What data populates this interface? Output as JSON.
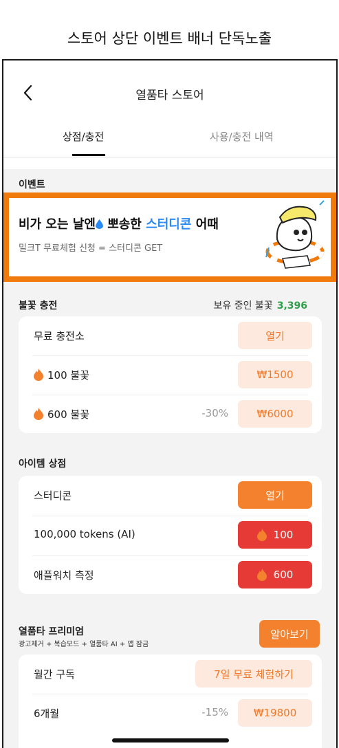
{
  "caption": "스토어 상단 이벤트 배너 단독노출",
  "nav": {
    "title": "열품타 스토어"
  },
  "tabs": {
    "shop": "상점/충전",
    "history": "사용/충전 내역"
  },
  "event": {
    "label": "이벤트",
    "banner": {
      "title_part1": "비가 오는 날엔",
      "title_part2": "뽀송한",
      "title_highlight": "스터디콘",
      "title_part3": "어때",
      "subtitle": "밀크T 무료체험 신청 = 스터디콘 GET"
    }
  },
  "charge": {
    "label": "불꽃 충전",
    "balance_label": "보유 중인 불꽃",
    "balance_value": "3,396",
    "rows": [
      {
        "label": "무료 충전소",
        "button": "열기"
      },
      {
        "label": "100 불꽃",
        "button": "₩1500"
      },
      {
        "label": "600 불꽃",
        "discount": "-30%",
        "button": "₩6000"
      }
    ]
  },
  "items": {
    "label": "아이템 상점",
    "rows": [
      {
        "label": "스터디콘",
        "button": "열기"
      },
      {
        "label": "100,000 tokens (AI)",
        "button": "100"
      },
      {
        "label": "애플워치 측정",
        "button": "600"
      }
    ]
  },
  "premium": {
    "title": "열품타 프리미엄",
    "subtitle": "광고제거 + 복습모드 + 열품타 AI + 앱 잠금",
    "button": "알아보기",
    "rows": [
      {
        "label": "월간 구독",
        "button": "7일 무료 체험하기"
      },
      {
        "label": "6개월",
        "discount": "-15%",
        "button": "₩19800"
      }
    ]
  },
  "colors": {
    "accent": "#f07a0c",
    "button_orange": "#f4812d",
    "button_red": "#e63a36",
    "balance_green": "#2f9e4b",
    "highlight_blue": "#2a8af5"
  },
  "icons": [
    "back-arrow-icon",
    "water-drop-icon",
    "flame-icon"
  ]
}
